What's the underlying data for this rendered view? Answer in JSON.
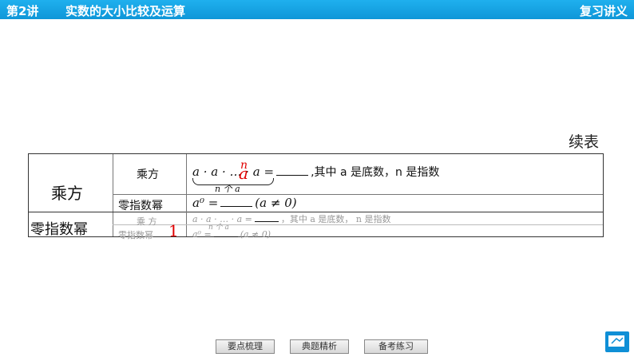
{
  "header": {
    "lecture": "第2讲",
    "title": "实数的大小比较及运算",
    "review": "复习讲义"
  },
  "table": {
    "continued": "续表",
    "left_top": "乘方",
    "left_bottom": "零指数幂",
    "row1_label": "乘方",
    "row1_formula": "a · a · … · a",
    "row1_equals": "=",
    "row1_desc": ",其中 a 是底数，n 是指数",
    "row1_under": "n 个 a",
    "row2_label": "零指数幂",
    "row2_formula": "a⁰ =",
    "row2_cond": "(a ≠ 0)",
    "ghost_row1_label": "乘 方",
    "ghost_row1_formula": "a · a · … · a =",
    "ghost_row1_desc": "，其中 a 是底数， n 是指数",
    "ghost_under": "n 个 a",
    "ghost_row2_label": "零指数幂",
    "ghost_row2_formula": "a⁰ =",
    "ghost_row2_cond": "(a ≠ 0)",
    "red_n": "n",
    "red_a": "a",
    "red_one": "1"
  },
  "nav": {
    "btn1": "要点梳理",
    "btn2": "典题精析",
    "btn3": "备考练习"
  }
}
